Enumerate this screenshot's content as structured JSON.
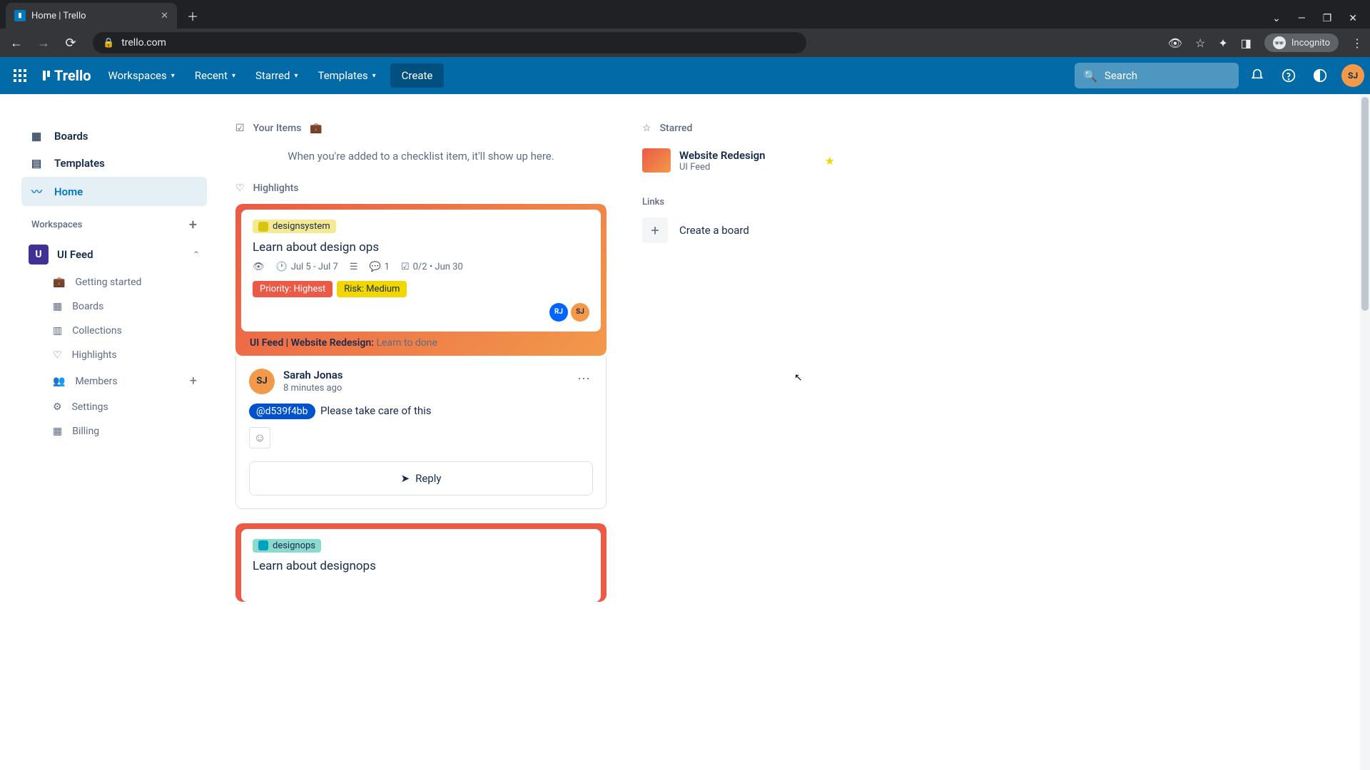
{
  "browser": {
    "tab_title": "Home | Trello",
    "url": "trello.com",
    "incognito_label": "Incognito"
  },
  "header": {
    "menus": {
      "workspaces": "Workspaces",
      "recent": "Recent",
      "starred": "Starred",
      "templates": "Templates"
    },
    "create": "Create",
    "search_placeholder": "Search",
    "avatar_initials": "SJ",
    "logo_text": "Trello"
  },
  "sidebar": {
    "boards": "Boards",
    "templates": "Templates",
    "home": "Home",
    "workspaces_label": "Workspaces",
    "workspace": {
      "initial": "U",
      "name": "UI Feed"
    },
    "sub": {
      "getting_started": "Getting started",
      "boards": "Boards",
      "collections": "Collections",
      "highlights": "Highlights",
      "members": "Members",
      "settings": "Settings",
      "billing": "Billing"
    }
  },
  "main": {
    "your_items": "Your Items",
    "empty": "When you're added to a checklist item, it'll show up here.",
    "highlights": "Highlights",
    "card1": {
      "label": "designsystem",
      "title": "Learn about design ops",
      "dates": "Jul 5 - Jul 7",
      "comments": "1",
      "checklist": "0/2 • Jun 30",
      "priority": "Priority: Highest",
      "risk": "Risk: Medium",
      "av1": "RJ",
      "av2": "SJ",
      "breadcrumb_bold": "UI Feed | Website Redesign:",
      "breadcrumb_rest": "Learn to done"
    },
    "comment": {
      "av": "SJ",
      "name": "Sarah Jonas",
      "time": "8 minutes ago",
      "mention": "@d539f4bb",
      "text": "Please take care of this",
      "reply": "Reply"
    },
    "card2": {
      "label": "designops",
      "title": "Learn about designops"
    }
  },
  "right": {
    "starred": "Starred",
    "board_name": "Website Redesign",
    "board_ws": "UI Feed",
    "links": "Links",
    "create_board": "Create a board"
  }
}
